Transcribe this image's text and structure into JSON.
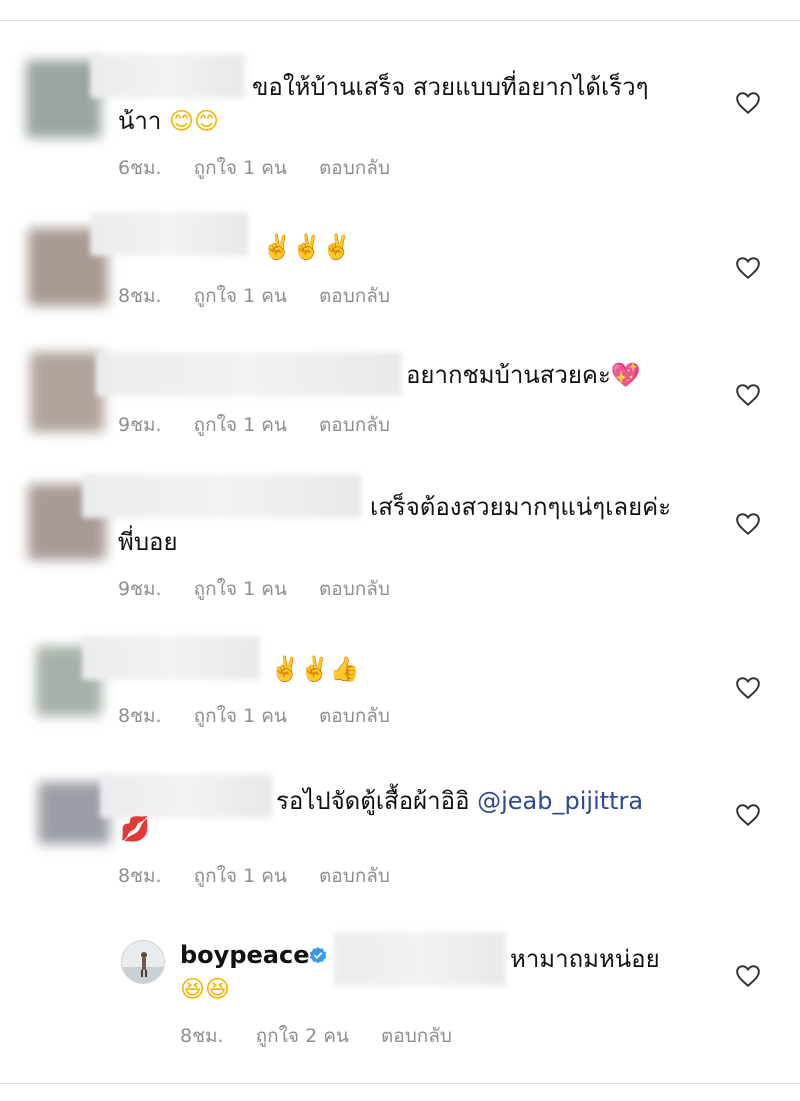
{
  "comments": [
    {
      "line1": "ขอให้บ้านเสร็จ สวยแบบที่อยากได้เร็วๆ",
      "line2": "น้าา",
      "emoji": "😊😊",
      "time": "6ชม.",
      "likes": "ถูกใจ 1 คน",
      "reply": "ตอบกลับ"
    },
    {
      "line1": "",
      "emoji": "✌️✌️✌️",
      "time": "8ชม.",
      "likes": "ถูกใจ 1 คน",
      "reply": "ตอบกลับ"
    },
    {
      "line1": "อยากชมบ้านสวยคะ",
      "emoji": "💖",
      "time": "9ชม.",
      "likes": "ถูกใจ 1 คน",
      "reply": "ตอบกลับ"
    },
    {
      "line1": "เสร็จต้องสวยมากๆแน่ๆเลยค่ะ",
      "line2": "พี่บอย",
      "time": "9ชม.",
      "likes": "ถูกใจ 1 คน",
      "reply": "ตอบกลับ"
    },
    {
      "line1": "",
      "emoji": "✌️✌️👍",
      "time": "8ชม.",
      "likes": "ถูกใจ 1 คน",
      "reply": "ตอบกลับ"
    },
    {
      "line1": "รอไปจัดตู้เสื้อผ้าอิอิ",
      "mention": "@jeab_pijittra",
      "emoji": "💋",
      "time": "8ชม.",
      "likes": "ถูกใจ 1 คน",
      "reply": "ตอบกลับ"
    }
  ],
  "reply": {
    "username": "boypeace",
    "text": "หามาถมหน่อย",
    "emoji": "😆😆",
    "time": "8ชม.",
    "likes": "ถูกใจ 2 คน",
    "reply": "ตอบกลับ"
  },
  "icons": {
    "heart": "heart-outline-icon",
    "verified": "verified-badge-icon"
  },
  "colors": {
    "mention": "#2e4a8a",
    "meta": "#8e8e8e",
    "verified": "#3897f0"
  }
}
